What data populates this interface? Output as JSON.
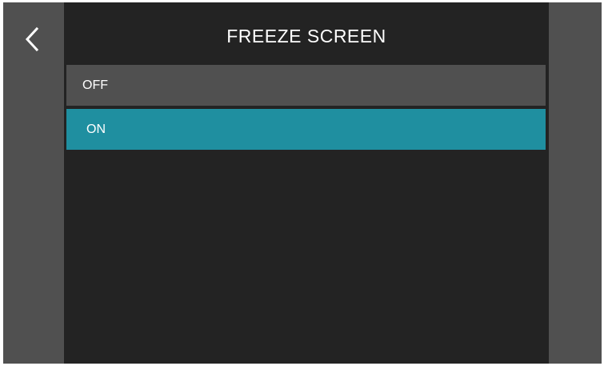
{
  "header": {
    "title": "FREEZE SCREEN",
    "back_icon": "chevron-left-icon"
  },
  "options": [
    {
      "label": "OFF",
      "selected": false
    },
    {
      "label": "ON",
      "selected": true
    }
  ],
  "colors": {
    "background_dark": "#232323",
    "rail_gray": "#505050",
    "selected_accent": "#1f8fa0",
    "text": "#ffffff"
  }
}
